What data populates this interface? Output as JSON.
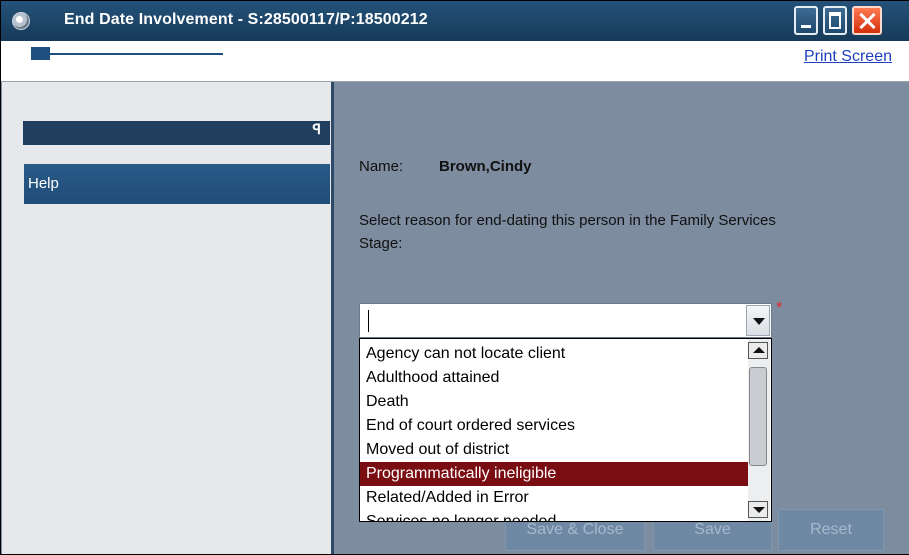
{
  "window": {
    "title": "End Date Involvement - S:28500117/P:18500212",
    "icons": [
      "app-icon",
      "minimize-icon",
      "maximize-icon",
      "close-icon"
    ]
  },
  "toolbar": {
    "print_label": "Print Screen"
  },
  "sidebar": {
    "pin_glyph": "ꟼ",
    "help_label": "Help"
  },
  "form": {
    "name_label": "Name:",
    "name_value": "Brown,Cindy",
    "prompt": "Select reason for end-dating this person in the Family Services Stage:",
    "reason_value": "",
    "required_marker": "*",
    "options": [
      "Agency can not locate client",
      "Adulthood attained",
      "Death",
      "End of court ordered services",
      "Moved out of district",
      "Programmatically ineligible",
      "Related/Added in Error",
      "Services no longer needed"
    ],
    "highlighted_option": "Programmatically ineligible"
  },
  "buttons": {
    "save_close": "Save & Close",
    "save": "Save",
    "reset": "Reset"
  },
  "colors": {
    "titlebar": "#1f4a70",
    "highlight": "#7a0d12",
    "panel": "#7d8c9f"
  }
}
